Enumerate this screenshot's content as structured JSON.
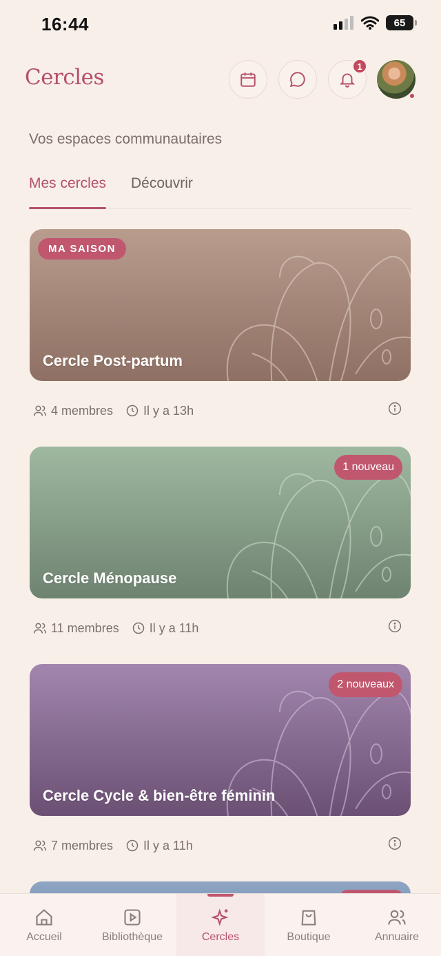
{
  "status_bar": {
    "time": "16:44",
    "battery": "65"
  },
  "header": {
    "title": "Cercles",
    "notification_count": "1"
  },
  "subtitle": "Vos espaces communautaires",
  "tabs": [
    {
      "label": "Mes cercles",
      "active": true
    },
    {
      "label": "Découvrir",
      "active": false
    }
  ],
  "circles": [
    {
      "title": "Cercle Post-partum",
      "tag": "MA SAISON",
      "badge": "",
      "members": "4 membres",
      "last_activity": "Il y a 13h",
      "color": "#9e8073"
    },
    {
      "title": "Cercle Ménopause",
      "tag": "",
      "badge": "1 nouveau",
      "members": "11 membres",
      "last_activity": "Il y a 11h",
      "color": "#869c88"
    },
    {
      "title": "Cercle Cycle & bien-être féminin",
      "tag": "",
      "badge": "2 nouveaux",
      "members": "7 membres",
      "last_activity": "Il y a 11h",
      "color": "#876b90"
    }
  ],
  "bottom_nav": [
    {
      "label": "Accueil",
      "icon": "home-icon"
    },
    {
      "label": "Bibliothèque",
      "icon": "play-square-icon"
    },
    {
      "label": "Cercles",
      "icon": "sparkles-icon",
      "active": true
    },
    {
      "label": "Boutique",
      "icon": "shopping-bag-icon"
    },
    {
      "label": "Annuaire",
      "icon": "users-icon"
    }
  ],
  "colors": {
    "accent": "#b5506a",
    "background": "#f8efe9",
    "badge": "#c0576e"
  }
}
